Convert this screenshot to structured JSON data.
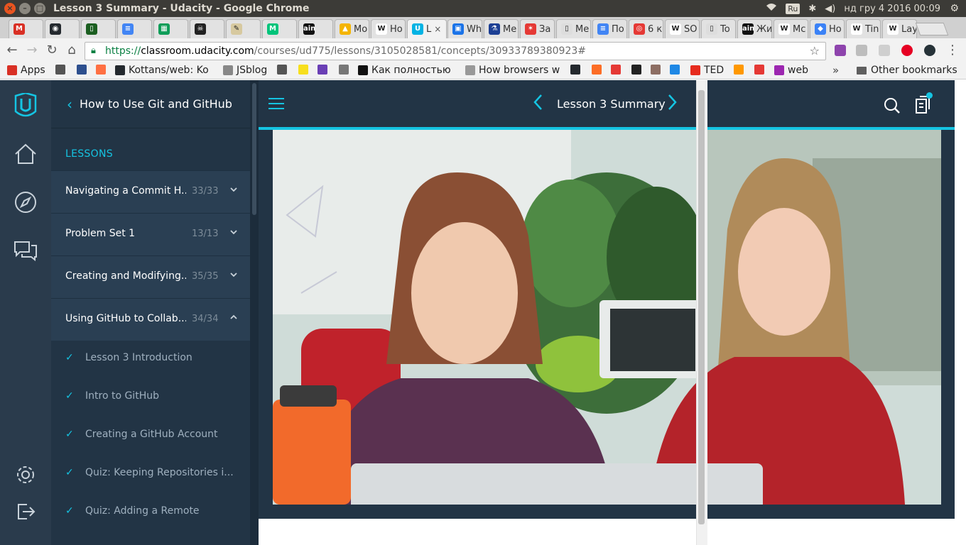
{
  "os": {
    "window_title": "Lesson 3 Summary - Udacity - Google Chrome",
    "keyboard_layout": "Ru",
    "clock": "нд гру  4 2016 00:09"
  },
  "tabs": [
    {
      "label": "",
      "color": "#d93025",
      "glyph": "M"
    },
    {
      "label": "",
      "color": "#24292e",
      "glyph": "◉"
    },
    {
      "label": "",
      "color": "#1b5e20",
      "glyph": "▯"
    },
    {
      "label": "",
      "color": "#4285f4",
      "glyph": "≡"
    },
    {
      "label": "",
      "color": "#0f9d58",
      "glyph": "▦"
    },
    {
      "label": "",
      "color": "#222",
      "glyph": "☠"
    },
    {
      "label": "",
      "color": "#d7c99f",
      "glyph": "✎"
    },
    {
      "label": "",
      "color": "#00c47a",
      "glyph": "M"
    },
    {
      "label": "",
      "color": "#111",
      "glyph": "ain"
    },
    {
      "label": "Mo",
      "color": "#f4b400",
      "glyph": "▲"
    },
    {
      "label": "Ho",
      "color": "#fff",
      "glyph": "W"
    },
    {
      "label": "L",
      "color": "#02b3e4",
      "glyph": "U",
      "active": true
    },
    {
      "label": "Wh",
      "color": "#1a73e8",
      "glyph": "▣"
    },
    {
      "label": "Me",
      "color": "#1c3f94",
      "glyph": "⚗"
    },
    {
      "label": "За",
      "color": "#e53935",
      "glyph": "✶"
    },
    {
      "label": "Me",
      "color": "#ddd",
      "glyph": "▯"
    },
    {
      "label": "По",
      "color": "#4285f4",
      "glyph": "≡"
    },
    {
      "label": "6 к",
      "color": "#e53935",
      "glyph": "◎"
    },
    {
      "label": "SO",
      "color": "#fff",
      "glyph": "W"
    },
    {
      "label": "To",
      "color": "#ddd",
      "glyph": "▯"
    },
    {
      "label": "Жи",
      "color": "#111",
      "glyph": "ain"
    },
    {
      "label": "Mc",
      "color": "#fff",
      "glyph": "W"
    },
    {
      "label": "Ho",
      "color": "#3b82f6",
      "glyph": "◆"
    },
    {
      "label": "Tin",
      "color": "#fff",
      "glyph": "W"
    },
    {
      "label": "Lay",
      "color": "#fff",
      "glyph": "W"
    }
  ],
  "address_bar": {
    "scheme": "https://",
    "host": "classroom.udacity.com",
    "path": "/courses/ud775/lessons/3105028581/concepts/30933789380923#"
  },
  "bookmarks": [
    {
      "label": "Apps",
      "color": "#d93025"
    },
    {
      "label": "",
      "color": "#555"
    },
    {
      "label": "",
      "color": "#2d4f8e"
    },
    {
      "label": "",
      "color": "#ff7043"
    },
    {
      "label": "Kottans/web: Ko",
      "color": "#24292e"
    },
    {
      "label": "JSblog",
      "color": "#888"
    },
    {
      "label": "",
      "color": "#555"
    },
    {
      "label": "",
      "color": "#f7df1e"
    },
    {
      "label": "",
      "color": "#6a3fb5"
    },
    {
      "label": "",
      "color": "#777"
    },
    {
      "label": "Как полностью г",
      "color": "#111"
    },
    {
      "label": "How browsers w",
      "color": "#999"
    },
    {
      "label": "",
      "color": "#24292e"
    },
    {
      "label": "",
      "color": "#fc6d26"
    },
    {
      "label": "",
      "color": "#e53935"
    },
    {
      "label": "",
      "color": "#222"
    },
    {
      "label": "",
      "color": "#8d6e63"
    },
    {
      "label": "",
      "color": "#1e88e5"
    },
    {
      "label": "TED",
      "color": "#e62b1e"
    },
    {
      "label": "",
      "color": "#ff9800"
    },
    {
      "label": "",
      "color": "#e53935"
    },
    {
      "label": "web",
      "color": "#9c27b0"
    }
  ],
  "other_bookmarks": "Other bookmarks",
  "sidebar": {
    "course_title": "How to Use Git and GitHub",
    "section_label": "LESSONS",
    "lessons": [
      {
        "name": "Navigating a Commit H...",
        "count": "33/33",
        "expanded": false
      },
      {
        "name": "Problem Set 1",
        "count": "13/13",
        "expanded": false
      },
      {
        "name": "Creating and Modifying...",
        "count": "35/35",
        "expanded": false
      },
      {
        "name": "Using GitHub to Collab...",
        "count": "34/34",
        "expanded": true
      }
    ],
    "concepts": [
      "Lesson 3 Introduction",
      "Intro to GitHub",
      "Creating a GitHub Account",
      "Quiz: Keeping Repositories i...",
      "Quiz: Adding a Remote"
    ]
  },
  "header": {
    "lesson_title": "Lesson 3 Summary"
  },
  "colors": {
    "accent": "#15c4e2",
    "navy": "#223445",
    "rail": "#2a3b4c"
  }
}
